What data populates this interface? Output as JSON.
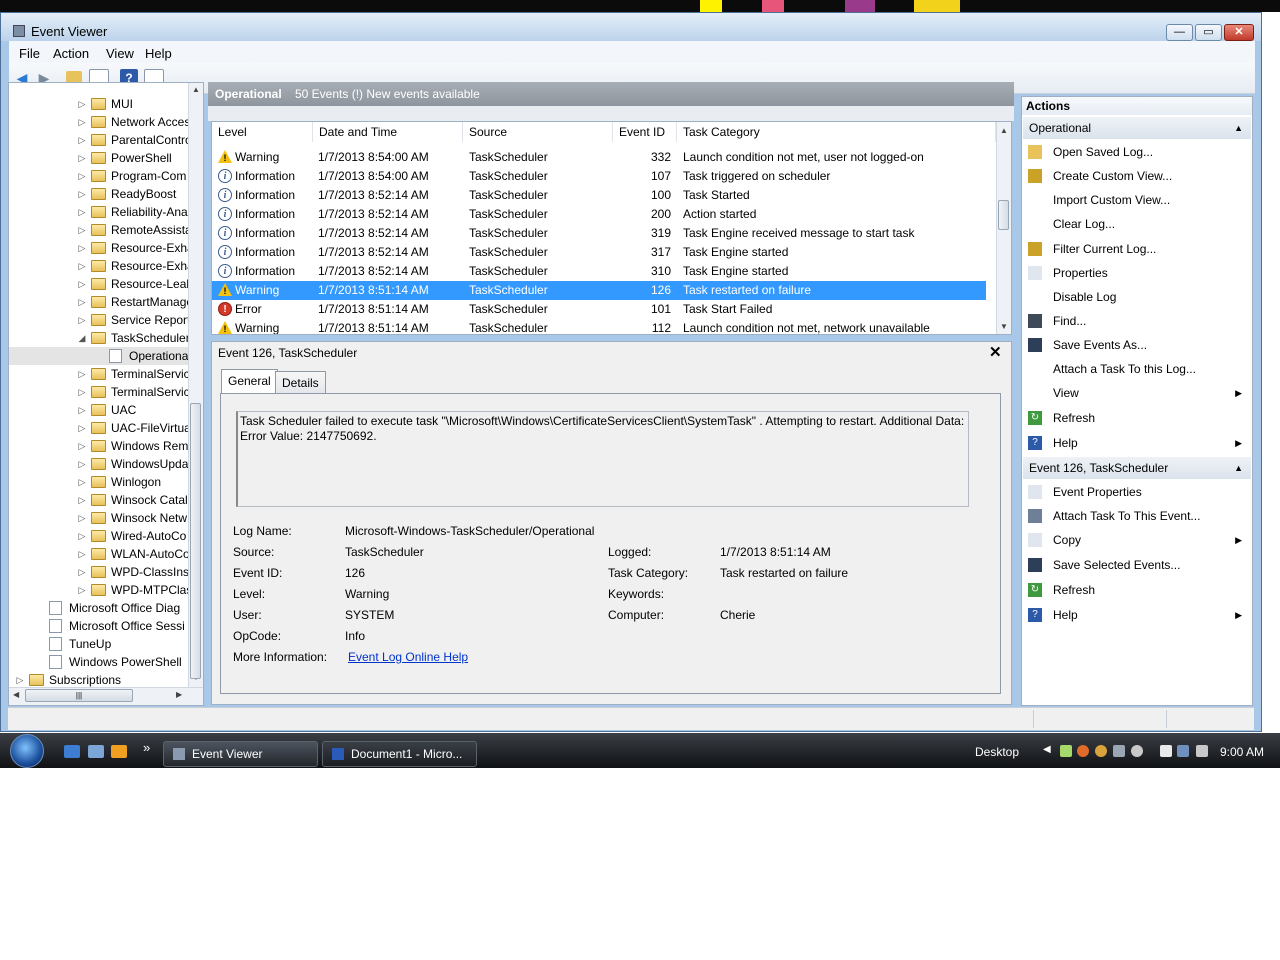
{
  "window": {
    "title": "Event Viewer",
    "minimize_glyph": "—",
    "maximize_glyph": "▭",
    "close_glyph": "✕"
  },
  "menu": [
    "File",
    "Action",
    "View",
    "Help"
  ],
  "tree": {
    "items": [
      {
        "label": "MUI",
        "depth": 4,
        "type": "folder"
      },
      {
        "label": "Network Acces",
        "depth": 4,
        "type": "folder"
      },
      {
        "label": "ParentalContro",
        "depth": 4,
        "type": "folder"
      },
      {
        "label": "PowerShell",
        "depth": 4,
        "type": "folder"
      },
      {
        "label": "Program-Com",
        "depth": 4,
        "type": "folder"
      },
      {
        "label": "ReadyBoost",
        "depth": 4,
        "type": "folder"
      },
      {
        "label": "Reliability-Ana",
        "depth": 4,
        "type": "folder"
      },
      {
        "label": "RemoteAssista",
        "depth": 4,
        "type": "folder"
      },
      {
        "label": "Resource-Exha",
        "depth": 4,
        "type": "folder"
      },
      {
        "label": "Resource-Exha",
        "depth": 4,
        "type": "folder"
      },
      {
        "label": "Resource-Leak",
        "depth": 4,
        "type": "folder"
      },
      {
        "label": "RestartManage",
        "depth": 4,
        "type": "folder"
      },
      {
        "label": "Service Report",
        "depth": 4,
        "type": "folder"
      },
      {
        "label": "TaskScheduler",
        "depth": 4,
        "type": "folder-open"
      },
      {
        "label": "Operationa",
        "depth": 5,
        "type": "log"
      },
      {
        "label": "TerminalServic",
        "depth": 4,
        "type": "folder"
      },
      {
        "label": "TerminalServic",
        "depth": 4,
        "type": "folder"
      },
      {
        "label": "UAC",
        "depth": 4,
        "type": "folder"
      },
      {
        "label": "UAC-FileVirtua",
        "depth": 4,
        "type": "folder"
      },
      {
        "label": "Windows Rem",
        "depth": 4,
        "type": "folder"
      },
      {
        "label": "WindowsUpda",
        "depth": 4,
        "type": "folder"
      },
      {
        "label": "Winlogon",
        "depth": 4,
        "type": "folder"
      },
      {
        "label": "Winsock Catal",
        "depth": 4,
        "type": "folder"
      },
      {
        "label": "Winsock Netw",
        "depth": 4,
        "type": "folder"
      },
      {
        "label": "Wired-AutoCo",
        "depth": 4,
        "type": "folder"
      },
      {
        "label": "WLAN-AutoCo",
        "depth": 4,
        "type": "folder"
      },
      {
        "label": "WPD-ClassInst",
        "depth": 4,
        "type": "folder"
      },
      {
        "label": "WPD-MTPClas",
        "depth": 4,
        "type": "folder"
      },
      {
        "label": "Microsoft Office Diag",
        "depth": 2,
        "type": "log"
      },
      {
        "label": "Microsoft Office Sessi",
        "depth": 2,
        "type": "log"
      },
      {
        "label": "TuneUp",
        "depth": 2,
        "type": "log"
      },
      {
        "label": "Windows PowerShell",
        "depth": 2,
        "type": "log"
      },
      {
        "label": "Subscriptions",
        "depth": 1,
        "type": "folder"
      }
    ]
  },
  "log_header": {
    "title": "Operational",
    "count": "50 Events (!) New events available"
  },
  "events": {
    "columns": [
      "Level",
      "Date and Time",
      "Source",
      "Event ID",
      "Task Category"
    ],
    "rows": [
      {
        "level": "Warning",
        "icon": "warning-icon",
        "datetime": "1/7/2013 8:54:00 AM",
        "source": "TaskScheduler",
        "id": "332",
        "category": "Launch condition not met, user not logged-on",
        "selected": false
      },
      {
        "level": "Information",
        "icon": "info-icon",
        "datetime": "1/7/2013 8:54:00 AM",
        "source": "TaskScheduler",
        "id": "107",
        "category": "Task triggered on scheduler",
        "selected": false
      },
      {
        "level": "Information",
        "icon": "info-icon",
        "datetime": "1/7/2013 8:52:14 AM",
        "source": "TaskScheduler",
        "id": "100",
        "category": "Task Started",
        "selected": false
      },
      {
        "level": "Information",
        "icon": "info-icon",
        "datetime": "1/7/2013 8:52:14 AM",
        "source": "TaskScheduler",
        "id": "200",
        "category": "Action started",
        "selected": false
      },
      {
        "level": "Information",
        "icon": "info-icon",
        "datetime": "1/7/2013 8:52:14 AM",
        "source": "TaskScheduler",
        "id": "319",
        "category": "Task Engine received message to start task",
        "selected": false
      },
      {
        "level": "Information",
        "icon": "info-icon",
        "datetime": "1/7/2013 8:52:14 AM",
        "source": "TaskScheduler",
        "id": "317",
        "category": "Task Engine started",
        "selected": false
      },
      {
        "level": "Information",
        "icon": "info-icon",
        "datetime": "1/7/2013 8:52:14 AM",
        "source": "TaskScheduler",
        "id": "310",
        "category": "Task Engine started",
        "selected": false
      },
      {
        "level": "Warning",
        "icon": "warning-icon",
        "datetime": "1/7/2013 8:51:14 AM",
        "source": "TaskScheduler",
        "id": "126",
        "category": "Task restarted on failure",
        "selected": true
      },
      {
        "level": "Error",
        "icon": "error-icon",
        "datetime": "1/7/2013 8:51:14 AM",
        "source": "TaskScheduler",
        "id": "101",
        "category": "Task Start Failed",
        "selected": false
      },
      {
        "level": "Warning",
        "icon": "warning-icon",
        "datetime": "1/7/2013 8:51:14 AM",
        "source": "TaskScheduler",
        "id": "112",
        "category": "Launch condition not met, network unavailable",
        "selected": false
      }
    ]
  },
  "detail": {
    "title": "Event 126, TaskScheduler",
    "tabs": [
      "General",
      "Details"
    ],
    "description_line1": "Task Scheduler failed to execute task \"\\Microsoft\\Windows\\CertificateServicesClient\\SystemTask\" . Attempting to restart. Additional Data:",
    "description_line2": "Error Value: 2147750692.",
    "props": {
      "log_name_label": "Log Name:",
      "log_name": "Microsoft-Windows-TaskScheduler/Operational",
      "source_label": "Source:",
      "source": "TaskScheduler",
      "logged_label": "Logged:",
      "logged": "1/7/2013 8:51:14 AM",
      "event_id_label": "Event ID:",
      "event_id": "126",
      "task_category_label": "Task Category:",
      "task_category": "Task restarted on failure",
      "level_label": "Level:",
      "level": "Warning",
      "keywords_label": "Keywords:",
      "keywords": "",
      "user_label": "User:",
      "user": "SYSTEM",
      "computer_label": "Computer:",
      "computer": "Cherie",
      "opcode_label": "OpCode:",
      "opcode": "Info",
      "more_info_label": "More Information:",
      "more_info_link": "Event Log Online Help"
    }
  },
  "actions": {
    "header": "Actions",
    "section1": "Operational",
    "section1_items": [
      {
        "label": "Open Saved Log...",
        "icon": "open-folder-icon",
        "submenu": false
      },
      {
        "label": "Create Custom View...",
        "icon": "filter-icon",
        "submenu": false
      },
      {
        "label": "Import Custom View...",
        "icon": "",
        "submenu": false
      },
      {
        "label": "Clear Log...",
        "icon": "",
        "submenu": false
      },
      {
        "label": "Filter Current Log...",
        "icon": "filter-icon",
        "submenu": false
      },
      {
        "label": "Properties",
        "icon": "properties-icon",
        "submenu": false
      },
      {
        "label": "Disable Log",
        "icon": "",
        "submenu": false
      },
      {
        "label": "Find...",
        "icon": "binoculars-icon",
        "submenu": false
      },
      {
        "label": "Save Events As...",
        "icon": "save-icon",
        "submenu": false
      },
      {
        "label": "Attach a Task To this Log...",
        "icon": "",
        "submenu": false
      },
      {
        "label": "View",
        "icon": "",
        "submenu": true
      },
      {
        "label": "Refresh",
        "icon": "refresh-icon",
        "submenu": false
      },
      {
        "label": "Help",
        "icon": "help-icon",
        "submenu": true
      }
    ],
    "section2": "Event 126, TaskScheduler",
    "section2_items": [
      {
        "label": "Event Properties",
        "icon": "properties-icon",
        "submenu": false
      },
      {
        "label": "Attach Task To This Event...",
        "icon": "task-icon",
        "submenu": false
      },
      {
        "label": "Copy",
        "icon": "copy-icon",
        "submenu": true
      },
      {
        "label": "Save Selected Events...",
        "icon": "save-icon",
        "submenu": false
      },
      {
        "label": "Refresh",
        "icon": "refresh-icon",
        "submenu": false
      },
      {
        "label": "Help",
        "icon": "help-icon",
        "submenu": true
      }
    ]
  },
  "taskbar": {
    "buttons": [
      "Event Viewer",
      "Document1 - Micro..."
    ],
    "desktop_label": "Desktop",
    "clock": "9:00 AM",
    "overflow_glyph": "»"
  }
}
